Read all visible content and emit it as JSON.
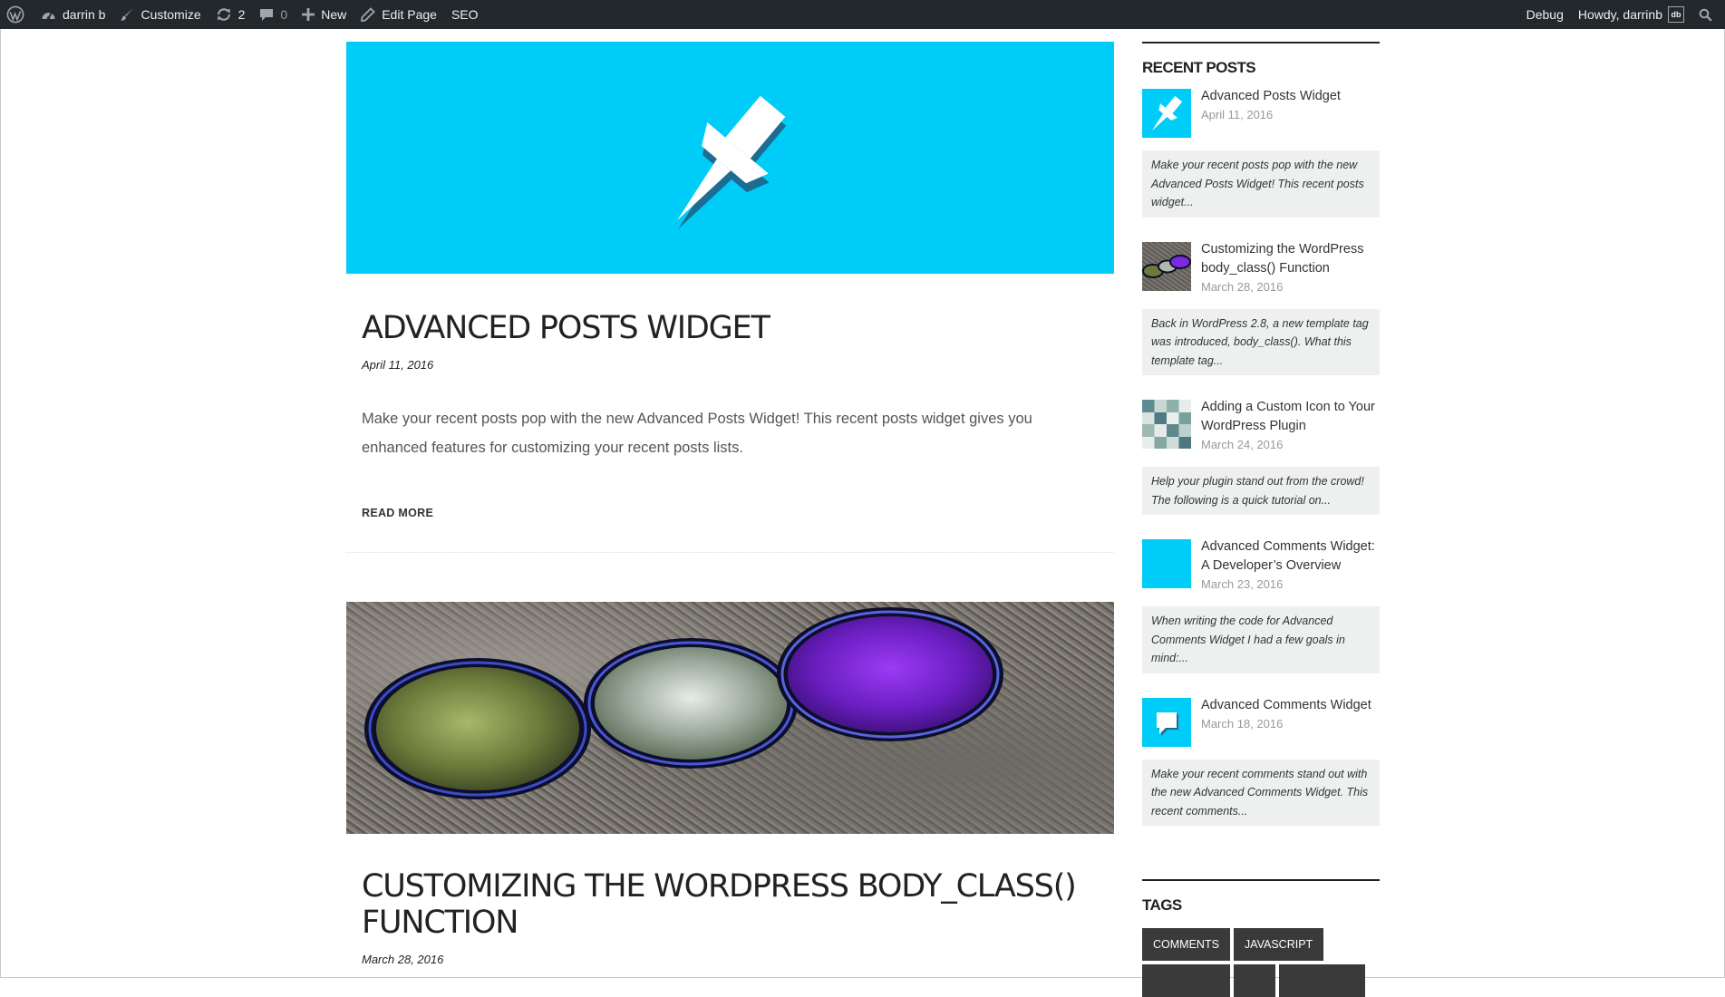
{
  "admin_bar": {
    "site_name": "darrin b",
    "customize": "Customize",
    "updates_count": "2",
    "comments_count": "0",
    "new": "New",
    "edit_page": "Edit Page",
    "seo": "SEO",
    "debug": "Debug",
    "howdy": "Howdy, darrinb",
    "avatar_initials": "db",
    "bg_color": "#23282d"
  },
  "main": {
    "posts": [
      {
        "image_icon": "pushpin-icon",
        "title": "ADVANCED POSTS WIDGET",
        "date": "April 11, 2016",
        "excerpt": "Make your recent posts pop with the new Advanced Posts Widget! This recent posts widget gives you enhanced features for customizing your recent posts lists.",
        "read_more": "READ MORE"
      },
      {
        "image_icon": "lens-filters-photo",
        "title": "CUSTOMIZING THE WORDPRESS BODY_CLASS() FUNCTION",
        "date": "March 28, 2016"
      }
    ],
    "accent_color": "#00ccf8"
  },
  "sidebar": {
    "recent_posts_title": "RECENT POSTS",
    "recent_posts": [
      {
        "thumb": "pushpin-icon",
        "title": "Advanced Posts Widget",
        "date": "April 11, 2016",
        "excerpt": "Make your recent posts pop with the new Advanced Posts Widget! This recent posts widget..."
      },
      {
        "thumb": "lens-filters-photo",
        "title": "Customizing the WordPress body_class() Function",
        "date": "March 28, 2016",
        "excerpt": "Back in WordPress 2.8, a new template tag was introduced, body_class(). What this template tag..."
      },
      {
        "thumb": "pixel-mosaic",
        "title": "Adding a Custom Icon to Your WordPress Plugin",
        "date": "March 24, 2016",
        "excerpt": "Help your plugin stand out from the crowd! The following is a quick tutorial on..."
      },
      {
        "thumb": "blank-blue",
        "title": "Advanced Comments Widget: A Developer’s Overview",
        "date": "March 23, 2016",
        "excerpt": "When writing the code for Advanced Comments Widget I had a few goals in mind:..."
      },
      {
        "thumb": "speech-bubble-icon",
        "title": "Advanced Comments Widget",
        "date": "March 18, 2016",
        "excerpt": "Make your recent comments stand out with the new Advanced Comments Widget. This recent comments..."
      }
    ],
    "tags_title": "TAGS",
    "tags": [
      "COMMENTS",
      "JAVASCRIPT"
    ]
  }
}
